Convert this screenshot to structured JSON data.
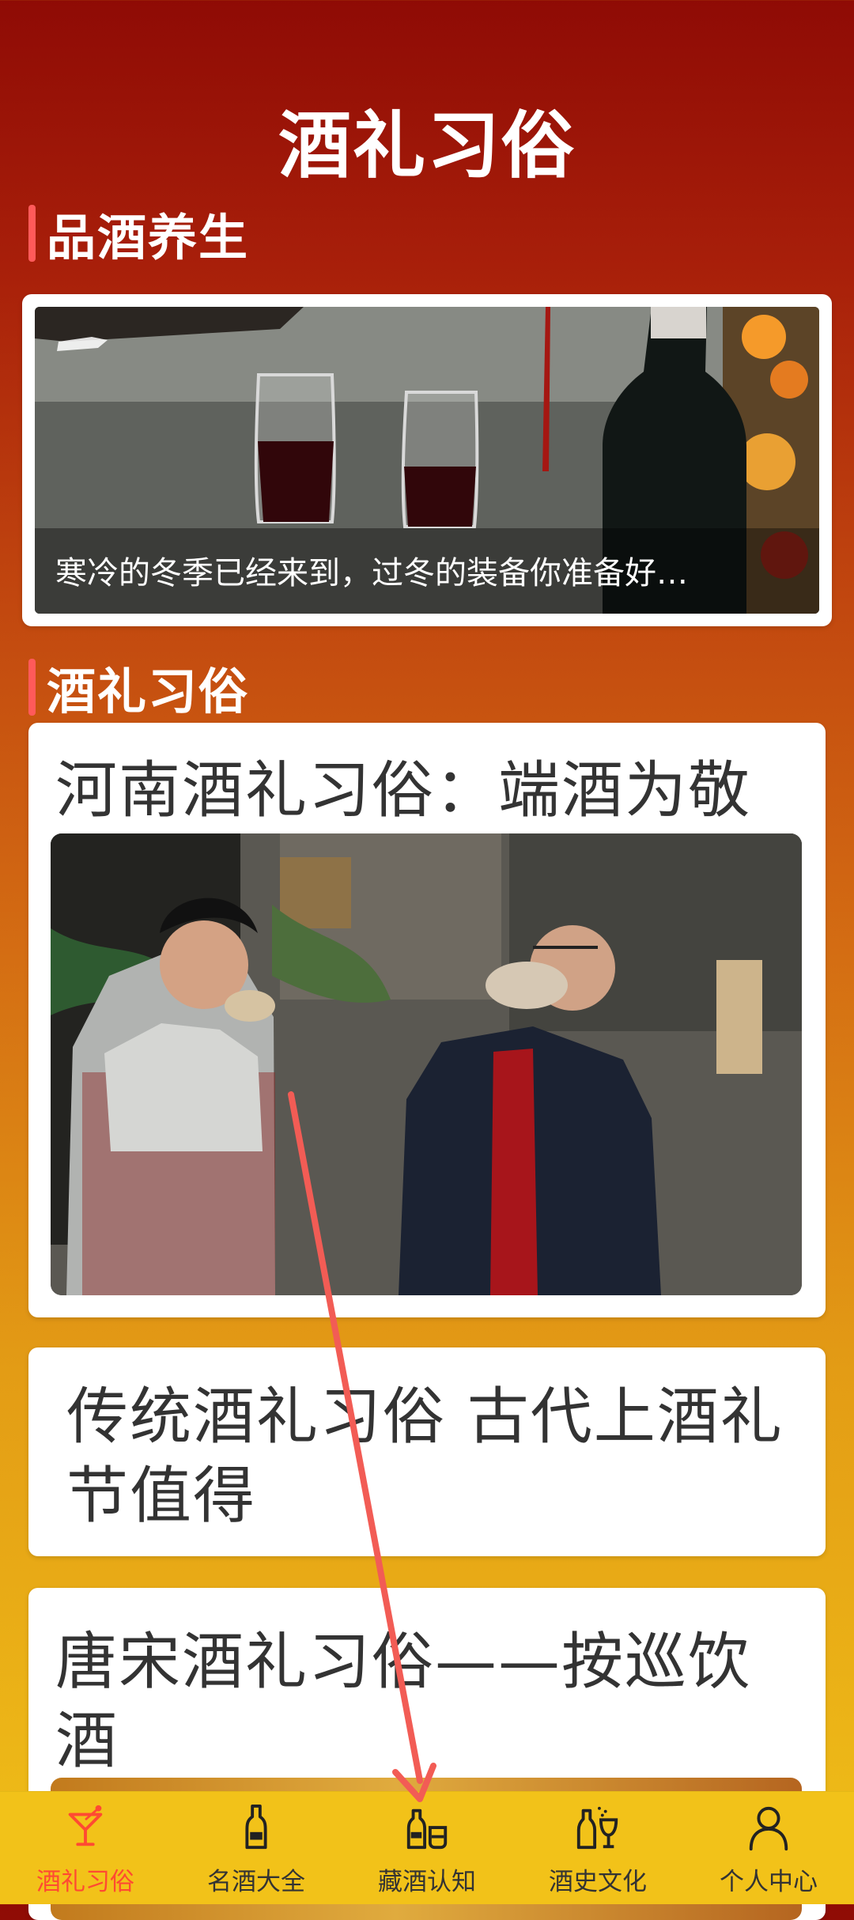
{
  "header": {
    "title": "酒礼习俗"
  },
  "sections": {
    "health": {
      "title": "品酒养生",
      "featured_caption": "寒冷的冬季已经来到，过冬的装备你准备好…"
    },
    "customs": {
      "title": "酒礼习俗",
      "articles": [
        {
          "title": "河南酒礼习俗：端酒为敬"
        },
        {
          "title": "传统酒礼习俗 古代上酒礼节值得"
        },
        {
          "title": "唐宋酒礼习俗——按巡饮酒"
        }
      ]
    }
  },
  "bottom_nav": {
    "items": [
      {
        "label": "酒礼习俗",
        "icon": "cocktail-glass-icon",
        "active": true
      },
      {
        "label": "名酒大全",
        "icon": "bottle-icon",
        "active": false
      },
      {
        "label": "藏酒认知",
        "icon": "bottle-glass-icon",
        "active": false
      },
      {
        "label": "酒史文化",
        "icon": "wine-culture-icon",
        "active": false
      },
      {
        "label": "个人中心",
        "icon": "person-icon",
        "active": false
      }
    ]
  },
  "colors": {
    "accent": "#ff4a32",
    "section_marker": "#ff5a5a",
    "gradient_top": "#8f0b05",
    "gradient_bottom": "#f0c018",
    "nav_background": "#f2c219",
    "gesture_arrow": "#f25c55"
  }
}
